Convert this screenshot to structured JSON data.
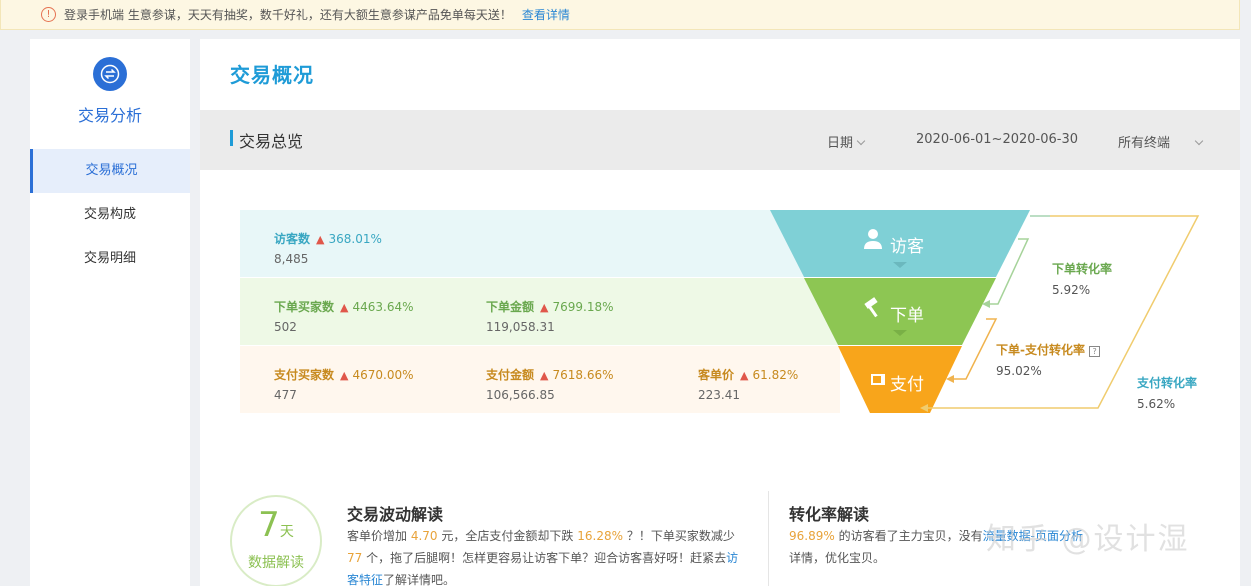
{
  "notice": {
    "text": "登录手机端 生意参谋，天天有抽奖，数千好礼，还有大额生意参谋产品免单每天送！",
    "link": "查看详情"
  },
  "sidebar": {
    "title": "交易分析",
    "items": [
      {
        "label": "交易概况",
        "active": true
      },
      {
        "label": "交易构成",
        "active": false
      },
      {
        "label": "交易明细",
        "active": false
      }
    ]
  },
  "main": {
    "page_title": "交易概况",
    "section_title": "交易总览",
    "filters": {
      "date_label": "日期",
      "date_range": "2020-06-01~2020-06-30",
      "terminal": "所有终端"
    }
  },
  "metrics": {
    "visitors": {
      "label": "访客数",
      "change": "368.01%",
      "value": "8,485"
    },
    "order_buyers": {
      "label": "下单买家数",
      "change": "4463.64%",
      "value": "502"
    },
    "order_amount": {
      "label": "下单金额",
      "change": "7699.18%",
      "value": "119,058.31"
    },
    "pay_buyers": {
      "label": "支付买家数",
      "change": "4670.00%",
      "value": "477"
    },
    "pay_amount": {
      "label": "支付金额",
      "change": "7618.66%",
      "value": "106,566.85"
    },
    "unit_price": {
      "label": "客单价",
      "change": "61.82%",
      "value": "223.41"
    }
  },
  "funnel": {
    "visitor_label": "访客",
    "order_label": "下单",
    "pay_label": "支付",
    "colors": {
      "visitor": "#7fd0d6",
      "order": "#8dc653",
      "pay": "#f8a51b"
    }
  },
  "conversions": {
    "order_rate": {
      "label": "下单转化率",
      "value": "5.92%"
    },
    "order_pay_rate": {
      "label": "下单-支付转化率",
      "value": "95.02%"
    },
    "pay_rate": {
      "label": "支付转化率",
      "value": "5.62%"
    }
  },
  "insights": {
    "badge_num": "7",
    "badge_unit": "天",
    "badge_sub": "数据解读",
    "left_title": "交易波动解读",
    "left_text_1": "客单价增加",
    "left_hl_1": "4.70",
    "left_text_2": "元，全店支付金额却下跌",
    "left_hl_2": "16.28%",
    "left_text_3": "？！下单买家数减少",
    "left_hl_3": "77",
    "left_text_4": "个，拖了后腿啊！怎样更容易让访客下单？迎合访客喜好呀！赶紧去",
    "left_link": "访客特征",
    "left_text_5": "了解详情吧。",
    "right_title": "转化率解读",
    "right_hl": "96.89%",
    "right_text_1": "的访客看了主力宝贝，没有",
    "right_link": "流量数据-页面分析",
    "right_text_2": "详情，优化宝贝。"
  },
  "watermark": "知乎 @设计湿"
}
